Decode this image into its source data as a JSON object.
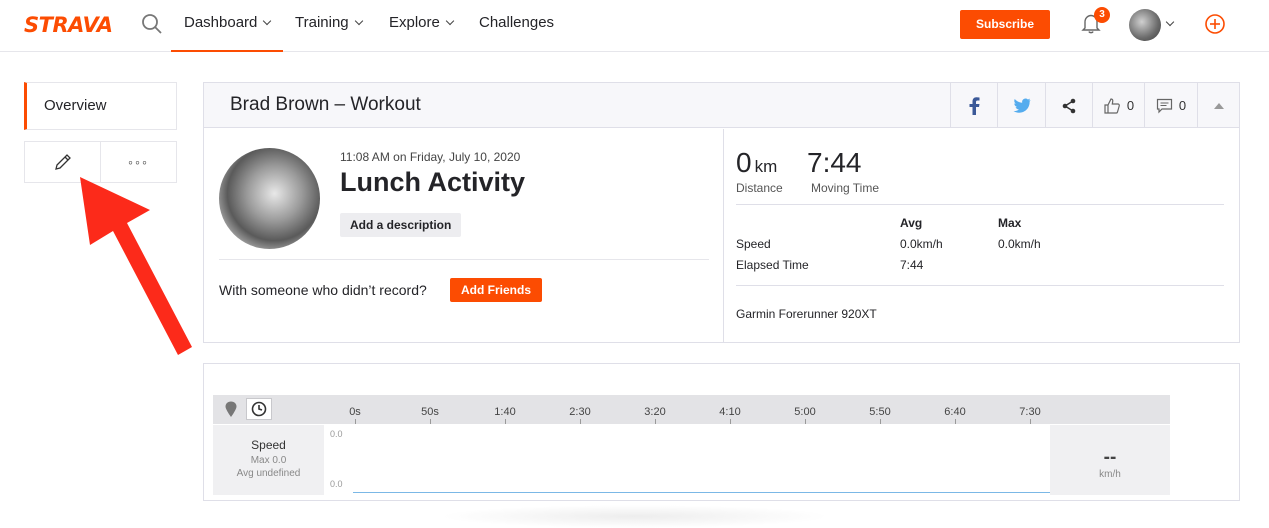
{
  "nav": {
    "logo": "STRAVA",
    "items": [
      {
        "label": "Dashboard"
      },
      {
        "label": "Training"
      },
      {
        "label": "Explore"
      },
      {
        "label": "Challenges"
      }
    ],
    "subscribe": "Subscribe",
    "notification_count": "3",
    "accent": "#fc4c02"
  },
  "sidebar": {
    "overview": "Overview",
    "more": "◦◦◦"
  },
  "activity": {
    "header_title": "Brad Brown – Workout",
    "kudos_count": "0",
    "comment_count": "0",
    "timestamp": "11:08 AM on Friday, July 10, 2020",
    "name": "Lunch Activity",
    "add_description": "Add a description",
    "with_someone": "With someone who didn’t record?",
    "add_friends": "Add Friends"
  },
  "stats": {
    "distance_value": "0",
    "distance_unit": "km",
    "distance_label": "Distance",
    "moving_time_value": "7:44",
    "moving_time_label": "Moving Time",
    "table": {
      "col_avg": "Avg",
      "col_max": "Max",
      "speed_label": "Speed",
      "speed_avg": "0.0km/h",
      "speed_max": "0.0km/h",
      "elapsed_label": "Elapsed Time",
      "elapsed_avg": "7:44"
    },
    "device": "Garmin Forerunner 920XT"
  },
  "chart": {
    "ticks": [
      "0s",
      "50s",
      "1:40",
      "2:30",
      "3:20",
      "4:10",
      "5:00",
      "5:50",
      "6:40",
      "7:30"
    ],
    "metric_name": "Speed",
    "metric_max": "Max 0.0",
    "metric_avg": "Avg undefined",
    "y_top": "0.0",
    "y_bottom": "0.0",
    "current_value": "--",
    "current_unit": "km/h"
  },
  "chart_data": {
    "type": "line",
    "x": [
      "0s",
      "50s",
      "1:40",
      "2:30",
      "3:20",
      "4:10",
      "5:00",
      "5:50",
      "6:40",
      "7:30"
    ],
    "series": [
      {
        "name": "Speed",
        "values": [
          0,
          0,
          0,
          0,
          0,
          0,
          0,
          0,
          0,
          0
        ]
      }
    ],
    "ylim": [
      0,
      0
    ]
  }
}
